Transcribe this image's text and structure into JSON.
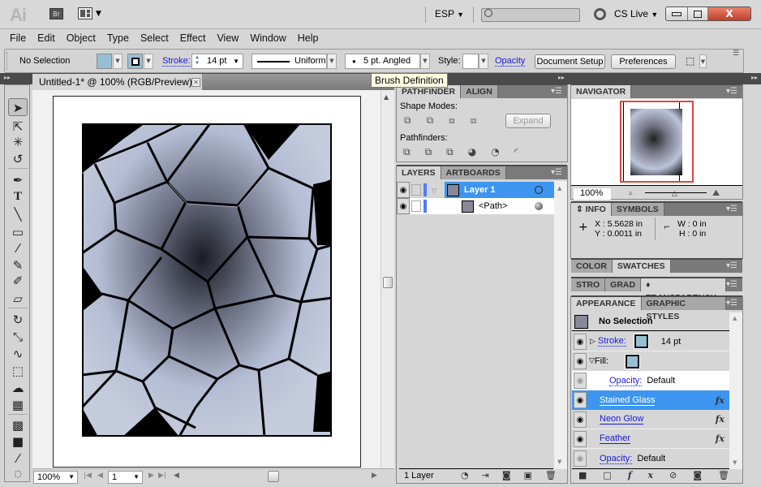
{
  "app": {
    "logo": "Ai",
    "bridge": "Br",
    "workspace": "ESP",
    "search_placeholder": "",
    "cslive": "CS Live"
  },
  "window_controls": {
    "minimize": "–",
    "maximize": "□",
    "close": "X"
  },
  "menu": [
    "File",
    "Edit",
    "Object",
    "Type",
    "Select",
    "Effect",
    "View",
    "Window",
    "Help"
  ],
  "control_bar": {
    "selection": "No Selection",
    "fill_color": "#97bfd4",
    "stroke_label": "Stroke:",
    "stroke_weight": "14 pt",
    "profile": "Uniform",
    "brush": "5 pt. Angled",
    "style_label": "Style:",
    "opacity_label": "Opacity",
    "document_setup": "Document Setup",
    "preferences": "Preferences"
  },
  "tooltip": "Brush Definition",
  "document": {
    "tab_title": "Untitled-1* @ 100% (RGB/Preview)",
    "zoom": "100%",
    "artboard": "1"
  },
  "pathfinder": {
    "tabs": [
      "PATHFINDER",
      "ALIGN"
    ],
    "shape_modes_label": "Shape Modes:",
    "expand": "Expand",
    "pathfinders_label": "Pathfinders:"
  },
  "layers": {
    "tabs": [
      "LAYERS",
      "ARTBOARDS"
    ],
    "rows": [
      {
        "name": "Layer 1"
      },
      {
        "name": "<Path>"
      }
    ],
    "footer": "1 Layer"
  },
  "navigator": {
    "tab": "NAVIGATOR",
    "zoom": "100%"
  },
  "info": {
    "tabs": [
      "INFO",
      "SYMBOLS"
    ],
    "x": "X  : 5.5628 in",
    "y": "Y  : 0.0011 in",
    "w": "W  : 0 in",
    "h": "H  : 0 in"
  },
  "color_tabs": [
    "COLOR",
    "SWATCHES"
  ],
  "stroke_tabs": [
    "STRO",
    "GRAD",
    "♦ TRANSPARENCY"
  ],
  "appearance": {
    "tabs": [
      "APPEARANCE",
      "GRAPHIC STYLES"
    ],
    "header": "No Selection",
    "stroke_label": "Stroke:",
    "stroke_value": "14 pt",
    "fill_label": "Fill:",
    "fill_opacity_label": "Opacity:",
    "fill_opacity_value": "Default",
    "effects": [
      "Stained Glass",
      "Neon Glow",
      "Feather"
    ],
    "fx": "fx",
    "opacity_label": "Opacity:",
    "opacity_value": "Default"
  }
}
